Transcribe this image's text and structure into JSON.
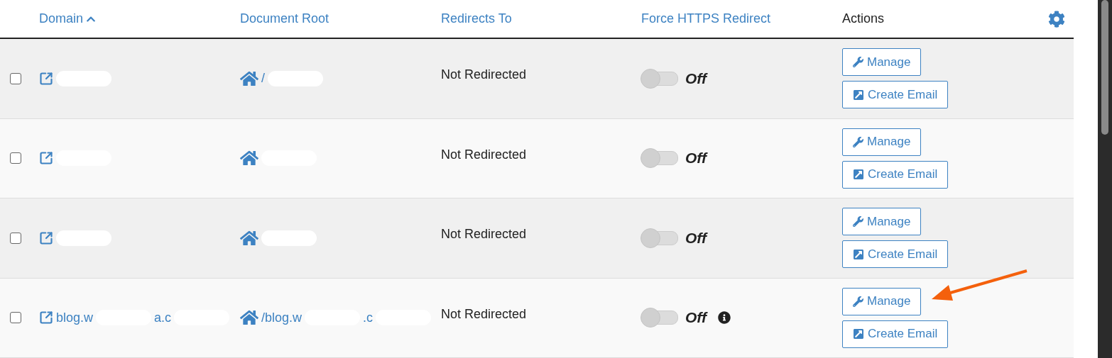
{
  "columns": [
    {
      "kind": "sort",
      "label": "Domain"
    },
    {
      "kind": "link",
      "label": "Document Root"
    },
    {
      "kind": "link",
      "label": "Redirects To"
    },
    {
      "kind": "link",
      "label": "Force HTTPS Redirect"
    },
    {
      "kind": "plain",
      "label": "Actions"
    }
  ],
  "rows": [
    {
      "checked": false,
      "domain": [
        {
          "kind": "redaction"
        }
      ],
      "root": [
        {
          "kind": "text",
          "text": "/"
        },
        {
          "kind": "redaction"
        }
      ],
      "redirects": "Not Redirected",
      "https": {
        "on": false,
        "label": "Off",
        "info": false
      },
      "actions": [
        {
          "kind": "manage",
          "label": "Manage"
        },
        {
          "kind": "email",
          "label": "Create Email"
        }
      ]
    },
    {
      "checked": false,
      "domain": [
        {
          "kind": "redaction"
        }
      ],
      "root": [
        {
          "kind": "redaction"
        }
      ],
      "redirects": "Not Redirected",
      "https": {
        "on": false,
        "label": "Off",
        "info": false
      },
      "actions": [
        {
          "kind": "manage",
          "label": "Manage"
        },
        {
          "kind": "email",
          "label": "Create Email"
        }
      ]
    },
    {
      "checked": false,
      "domain": [
        {
          "kind": "redaction"
        }
      ],
      "root": [
        {
          "kind": "redaction"
        }
      ],
      "redirects": "Not Redirected",
      "https": {
        "on": false,
        "label": "Off",
        "info": false
      },
      "actions": [
        {
          "kind": "manage",
          "label": "Manage"
        },
        {
          "kind": "email",
          "label": "Create Email"
        }
      ]
    },
    {
      "checked": false,
      "domain": [
        {
          "kind": "text",
          "text": "blog.w"
        },
        {
          "kind": "redaction"
        },
        {
          "kind": "text",
          "text": "a.c"
        },
        {
          "kind": "redaction"
        }
      ],
      "root": [
        {
          "kind": "text",
          "text": "/blog.w"
        },
        {
          "kind": "redaction"
        },
        {
          "kind": "text",
          "text": ".c"
        },
        {
          "kind": "redaction"
        }
      ],
      "redirects": "Not Redirected",
      "https": {
        "on": false,
        "label": "Off",
        "info": true
      },
      "actions": [
        {
          "kind": "manage",
          "label": "Manage"
        },
        {
          "kind": "email",
          "label": "Create Email"
        }
      ]
    }
  ]
}
